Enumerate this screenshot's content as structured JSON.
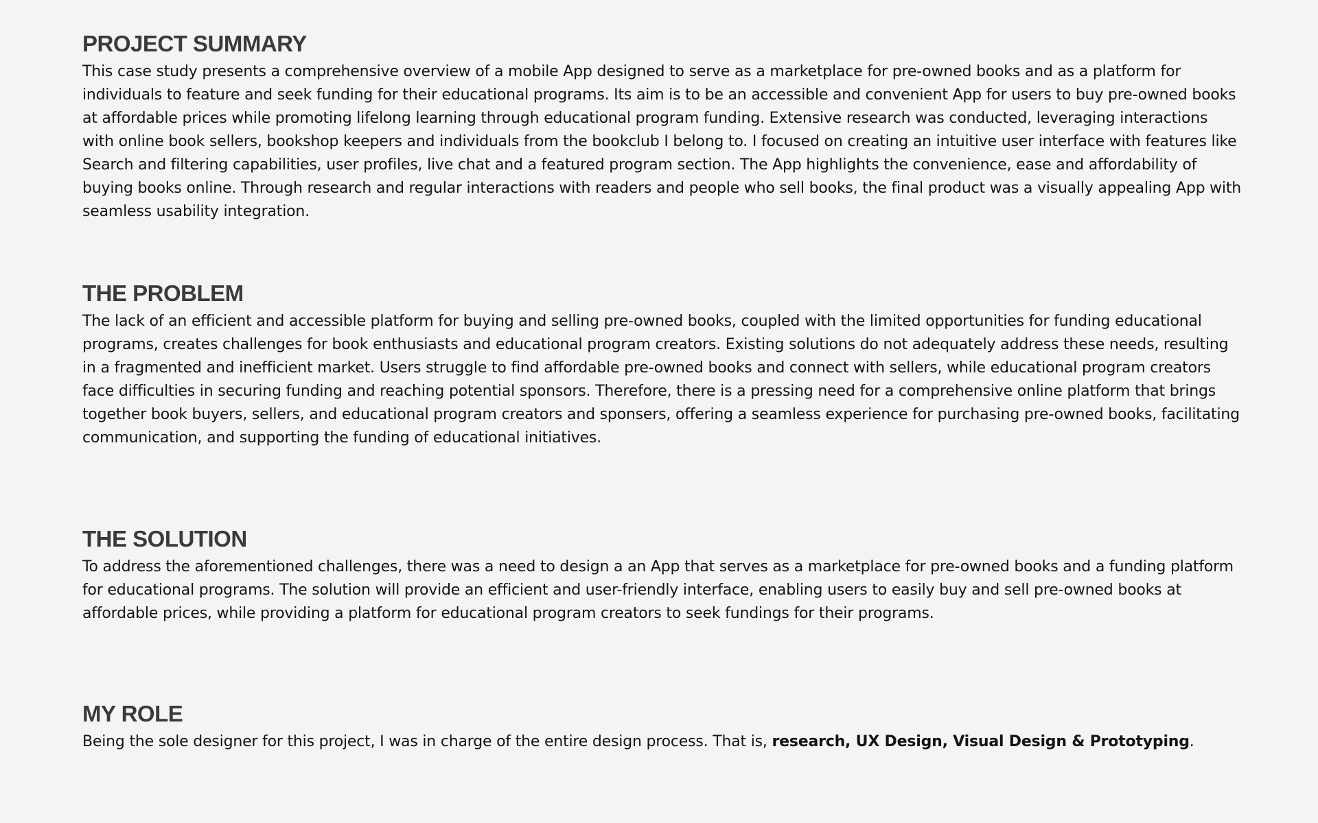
{
  "sections": {
    "summary": {
      "heading": "PROJECT SUMMARY",
      "body": "This case study presents a comprehensive overview of a mobile App designed to serve as a marketplace for pre-owned books and as a platform for individuals to feature and seek funding for their educational programs. Its aim is to be an accessible and convenient App for users to buy pre-owned books at affordable prices while promoting lifelong learning through educational program funding.  Extensive research was conducted, leveraging interactions with online book sellers, bookshop keepers and individuals from the bookclub I belong to. I focused on creating an intuitive user interface with features like Search and filtering capabilities, user profiles, live chat and a featured program section. The App highlights the convenience, ease and affordability of buying books online. Through research and regular interactions with readers and people who sell books, the final product was a visually appealing App with seamless usability integration."
    },
    "problem": {
      "heading": "THE PROBLEM",
      "body": "The lack of an efficient and accessible platform for buying and selling pre-owned books, coupled with the limited opportunities for funding educational programs, creates challenges for book enthusiasts and educational program creators. Existing solutions do not adequately address these needs, resulting in a fragmented and inefficient market. Users struggle to find affordable pre-owned books and connect with sellers, while  educational  program creators face difficulties in securing funding and reaching potential sponsors. Therefore, there is a pressing need for a comprehensive online platform that brings together book buyers, sellers, and educational program creators and sponsers, offering a seamless experience for purchasing pre-owned books, facilitating communication, and supporting the funding of educational initiatives."
    },
    "solution": {
      "heading": "THE SOLUTION",
      "body": "To address the aforementioned challenges, there was a need to design a an App that serves as a marketplace for pre-owned books and a funding platform for educational programs. The solution will provide an efficient and user-friendly interface, enabling users to easily buy and sell pre-owned books at affordable prices, while providing a platform for educational program creators to seek fundings for their programs."
    },
    "role": {
      "heading": "MY ROLE",
      "body_prefix": "Being the sole designer for this project, I was in charge of the entire design process. That is, ",
      "body_bold": "research, UX Design, Visual Design & Prototyping",
      "body_suffix": "."
    }
  },
  "colors": {
    "background": "#f4f4f2",
    "heading": "#3a3a3a",
    "body": "#141414"
  }
}
